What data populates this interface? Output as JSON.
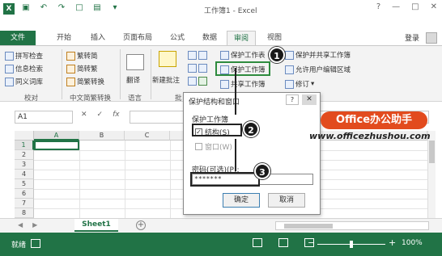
{
  "titlebar": {
    "app_icon": "X",
    "title": "工作簿1 - Excel",
    "controls": [
      "?",
      "—",
      "□",
      "✕"
    ]
  },
  "tabs": [
    {
      "label": "文件"
    },
    {
      "label": "开始"
    },
    {
      "label": "插入"
    },
    {
      "label": "页面布局"
    },
    {
      "label": "公式"
    },
    {
      "label": "数据"
    },
    {
      "label": "审阅"
    },
    {
      "label": "视图"
    }
  ],
  "account": {
    "login": "登录"
  },
  "ribbon": {
    "proofing": {
      "items": [
        "拼写检查",
        "信息检索",
        "同义词库"
      ],
      "label": "校对"
    },
    "chinese": {
      "items": [
        "繁转简",
        "简转繁",
        "简繁转换"
      ],
      "label": "中文简繁转换"
    },
    "language": {
      "item": "翻译",
      "label": "语言"
    },
    "comments": {
      "item": "新建批注",
      "label": "批"
    },
    "changes": {
      "protect_sheet": "保护工作表",
      "protect_workbook": "保护工作簿",
      "share_workbook": "共享工作簿",
      "protect_share": "保护并共享工作簿",
      "allow_edit": "允许用户编辑区域",
      "track_changes": "修订"
    }
  },
  "formula_bar": {
    "namebox": "A1",
    "fx": "fx"
  },
  "grid": {
    "columns": [
      "A",
      "B",
      "C"
    ],
    "rows": [
      "1",
      "2",
      "3",
      "4",
      "5",
      "6",
      "7",
      "8"
    ]
  },
  "sheets": {
    "active": "Sheet1"
  },
  "status": {
    "ready": "就绪",
    "zoom": "100%"
  },
  "dialog": {
    "title": "保护结构和窗口",
    "help": "?",
    "close": "✕",
    "group_label": "保护工作簿",
    "structure": "结构(S)",
    "windows": "窗口(W)",
    "password_label": "密码(可选)(P):",
    "password_value": "*******",
    "ok": "确定",
    "cancel": "取消"
  },
  "callouts": [
    "1",
    "2",
    "3"
  ],
  "watermark": {
    "badge": "Office办公助手",
    "url": "www.officezhushou.com"
  }
}
